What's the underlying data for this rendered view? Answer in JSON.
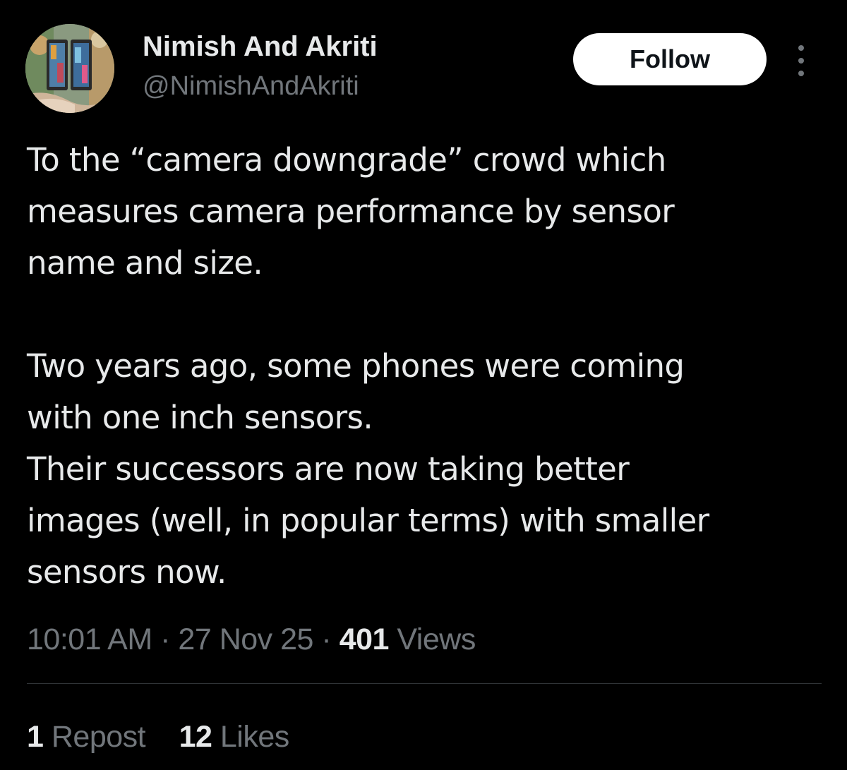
{
  "author": {
    "display_name": "Nimish And Akriti",
    "handle": "@NimishAndAkriti",
    "avatar_icon": "avatar-photo"
  },
  "actions": {
    "follow_label": "Follow",
    "more_icon": "more-vertical-icon"
  },
  "tweet": {
    "lines_paragraph_1": [
      "To the “camera downgrade” crowd which",
      "measures camera performance by sensor",
      "name and size."
    ],
    "lines_paragraph_2": [
      "Two years ago, some phones were coming",
      "with one inch sensors.",
      "Their successors are now taking better",
      "images (well, in popular terms) with smaller",
      "sensors now."
    ]
  },
  "meta": {
    "time": "10:01 AM",
    "separator": "·",
    "date": "27 Nov 25",
    "views_count": "401",
    "views_label": "Views"
  },
  "stats": {
    "reposts_count": "1",
    "reposts_label": "Repost",
    "likes_count": "12",
    "likes_label": "Likes"
  },
  "colors": {
    "background": "#000000",
    "primary_text": "#e7e9ea",
    "secondary_text": "#71767b",
    "divider": "#2f3336",
    "follow_button_bg": "#ffffff",
    "follow_button_text": "#0f1419"
  }
}
